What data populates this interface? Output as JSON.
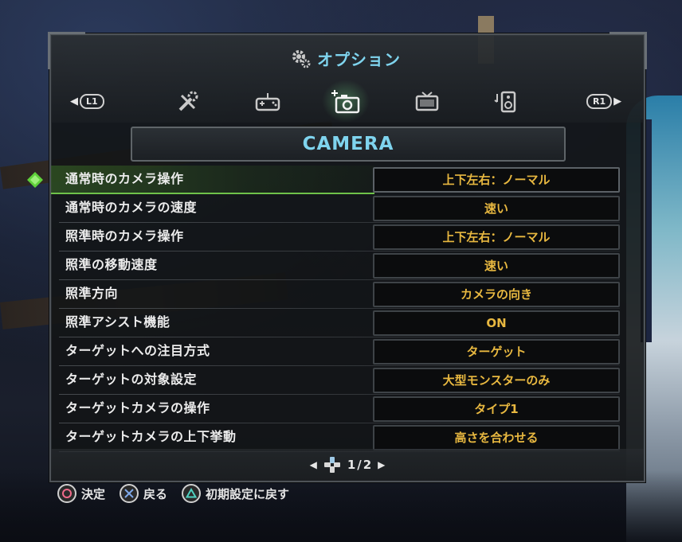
{
  "header": {
    "title": "オプション",
    "left_shoulder": "L1",
    "right_shoulder": "R1"
  },
  "tabs": [
    {
      "icon": "tools-icon",
      "active": false
    },
    {
      "icon": "controller-icon",
      "active": false
    },
    {
      "icon": "camera-icon",
      "active": true
    },
    {
      "icon": "display-icon",
      "active": false
    },
    {
      "icon": "sound-icon",
      "active": false
    }
  ],
  "section": {
    "title": "CAMERA"
  },
  "settings": [
    {
      "label": "通常時のカメラ操作",
      "value": "上下左右：ノーマル",
      "selected": true
    },
    {
      "label": "通常時のカメラの速度",
      "value": "速い"
    },
    {
      "label": "照準時のカメラ操作",
      "value": "上下左右：ノーマル"
    },
    {
      "label": "照準の移動速度",
      "value": "速い"
    },
    {
      "label": "照準方向",
      "value": "カメラの向き"
    },
    {
      "label": "照準アシスト機能",
      "value": "ON"
    },
    {
      "label": "ターゲットへの注目方式",
      "value": "ターゲット"
    },
    {
      "label": "ターゲットの対象設定",
      "value": "大型モンスターのみ"
    },
    {
      "label": "ターゲットカメラの操作",
      "value": "タイプ1"
    },
    {
      "label": "ターゲットカメラの上下挙動",
      "value": "高さを合わせる"
    }
  ],
  "pager": {
    "current": "1",
    "separator": "/",
    "total": "2"
  },
  "hints": [
    {
      "button": "circle-button-icon",
      "label": "決定"
    },
    {
      "button": "cross-button-icon",
      "label": "戻る"
    },
    {
      "button": "triangle-button-icon",
      "label": "初期設定に戻す"
    }
  ],
  "colors": {
    "accent_title": "#7fd4ee",
    "value_text": "#e8b840",
    "selection_green": "#6fc24a"
  }
}
